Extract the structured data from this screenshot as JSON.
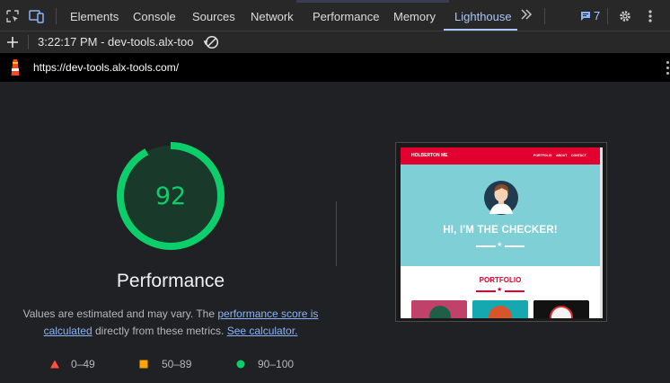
{
  "devtools": {
    "tabs": [
      {
        "label": "Elements"
      },
      {
        "label": "Console"
      },
      {
        "label": "Sources"
      },
      {
        "label": "Network"
      },
      {
        "label": "Performance"
      },
      {
        "label": "Memory"
      },
      {
        "label": "Lighthouse"
      }
    ],
    "active_tab": "Lighthouse",
    "more_tabs_icon": "chevron-double-right-icon",
    "issues_count": "7",
    "report_selector": "3:22:17 PM - dev-tools.alx-too",
    "report_url": "https://dev-tools.alx-tools.com/"
  },
  "report": {
    "score": "92",
    "score_color": "#0cce6b",
    "category": "Performance",
    "desc_prefix": "Values are estimated and may vary. The ",
    "desc_link1": "performance score is calculated",
    "desc_middle": " directly from these metrics. ",
    "desc_link2": "See calculator.",
    "legend": [
      {
        "range": "0–49",
        "shape": "triangle",
        "color": "#ff4e42"
      },
      {
        "range": "50–89",
        "shape": "square",
        "color": "#ffa400"
      },
      {
        "range": "90–100",
        "shape": "circle",
        "color": "#0cce6b"
      }
    ]
  },
  "screenshot": {
    "brand": "HOLBERTON ME",
    "nav_links": [
      "PORTFOLIO",
      "ABOUT",
      "CONTACT"
    ],
    "hero_title": "HI, I'M THE CHECKER!",
    "section_title": "PORTFOLIO",
    "accent_color": "#e1002f",
    "hero_color": "#7ecfd6"
  }
}
